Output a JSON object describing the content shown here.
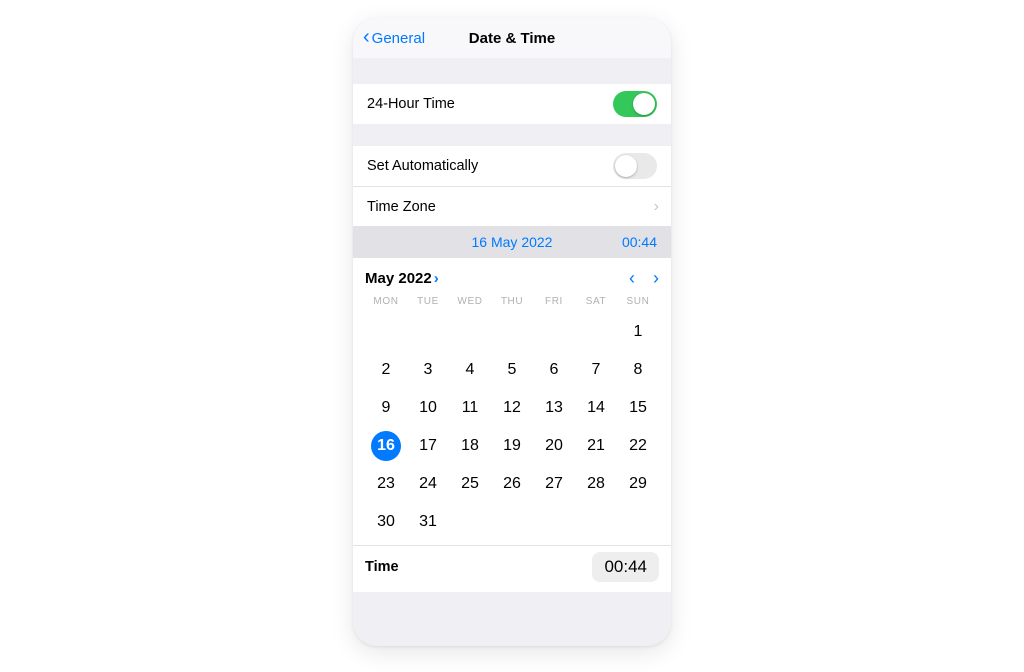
{
  "nav": {
    "back_label": "General",
    "title": "Date & Time"
  },
  "settings": {
    "hour24_label": "24-Hour Time",
    "hour24_on": true,
    "auto_label": "Set Automatically",
    "auto_on": false,
    "timezone_label": "Time Zone"
  },
  "selected": {
    "date": "16 May 2022",
    "time": "00:44"
  },
  "calendar": {
    "month_label": "May 2022",
    "dow": [
      "MON",
      "TUE",
      "WED",
      "THU",
      "FRI",
      "SAT",
      "SUN"
    ],
    "leading_blanks": 6,
    "days": 31,
    "selected_day": 16
  },
  "time_row": {
    "label": "Time",
    "value": "00:44"
  }
}
